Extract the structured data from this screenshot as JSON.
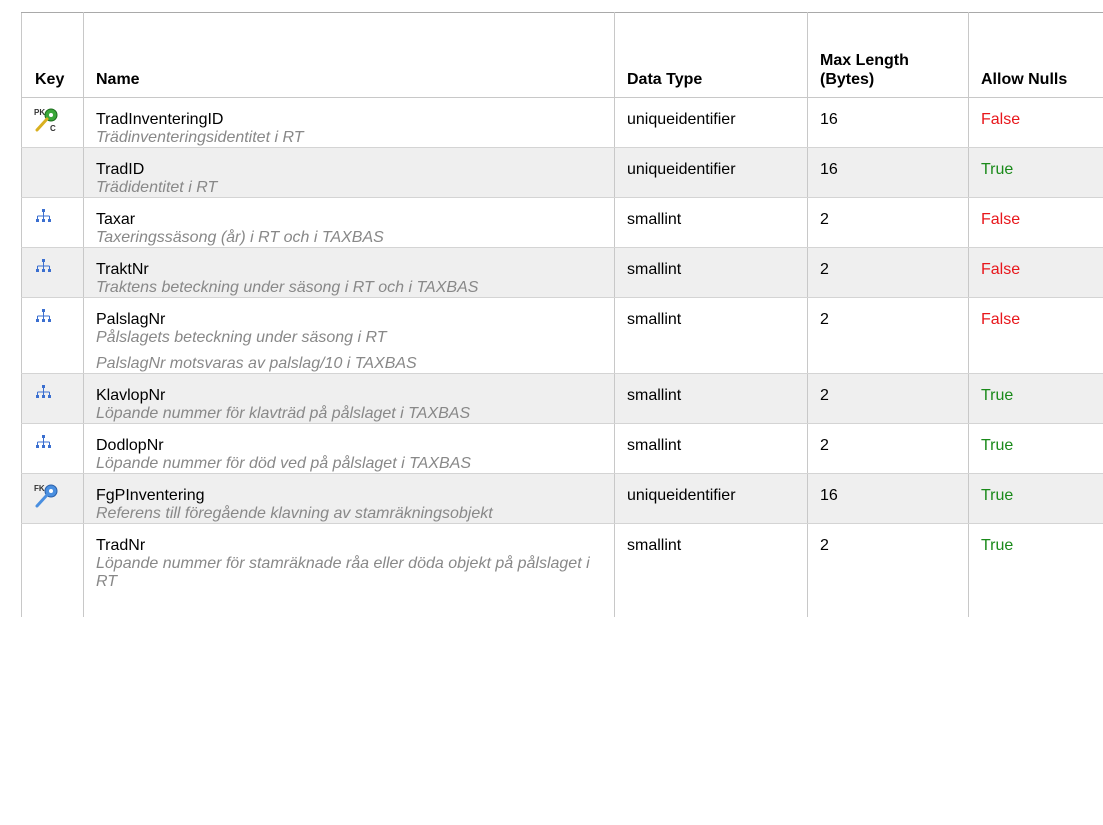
{
  "headers": {
    "key": "Key",
    "name": "Name",
    "data_type": "Data Type",
    "max_length_line1": "Max Length",
    "max_length_line2": "(Bytes)",
    "allow_nulls": "Allow Nulls"
  },
  "rows": [
    {
      "key_icon": "pk-clustered-key-icon",
      "name": "TradInventeringID",
      "desc": [
        "Trädinventeringsidentitet i RT"
      ],
      "type": "uniqueidentifier",
      "length": "16",
      "nulls": "False"
    },
    {
      "key_icon": "",
      "name": "TradID",
      "desc": [
        "Trädidentitet i RT"
      ],
      "type": "uniqueidentifier",
      "length": "16",
      "nulls": "True"
    },
    {
      "key_icon": "index-hierarchy-icon",
      "name": "Taxar",
      "desc": [
        "Taxeringssäsong (år) i RT och i TAXBAS"
      ],
      "type": "smallint",
      "length": "2",
      "nulls": "False"
    },
    {
      "key_icon": "index-hierarchy-icon",
      "name": "TraktNr",
      "desc": [
        "Traktens beteckning under säsong i RT och i TAXBAS"
      ],
      "type": "smallint",
      "length": "2",
      "nulls": "False"
    },
    {
      "key_icon": "index-hierarchy-icon",
      "name": "PalslagNr",
      "desc": [
        "Pålslagets beteckning under säsong i RT",
        "PalslagNr motsvaras av palslag/10 i TAXBAS"
      ],
      "type": "smallint",
      "length": "2",
      "nulls": "False"
    },
    {
      "key_icon": "index-hierarchy-icon",
      "name": "KlavlopNr",
      "desc": [
        "Löpande nummer för klavträd på pålslaget i TAXBAS"
      ],
      "type": "smallint",
      "length": "2",
      "nulls": "True"
    },
    {
      "key_icon": "index-hierarchy-icon",
      "name": "DodlopNr",
      "desc": [
        "Löpande nummer för död ved på pålslaget i TAXBAS"
      ],
      "type": "smallint",
      "length": "2",
      "nulls": "True"
    },
    {
      "key_icon": "foreign-key-icon",
      "name": "FgPInventering",
      "desc": [
        "Referens till föregående klavning av stamräkningsobjekt"
      ],
      "type": "uniqueidentifier",
      "length": "16",
      "nulls": "True"
    },
    {
      "key_icon": "",
      "name": "TradNr",
      "desc": [
        "Löpande nummer för stamräknade råa eller döda objekt på pålslaget i RT"
      ],
      "type": "smallint",
      "length": "2",
      "nulls": "True"
    }
  ],
  "colors": {
    "false": "#e8161b",
    "true": "#1a8a1a",
    "description": "#888888",
    "alt_row": "#efefef"
  }
}
